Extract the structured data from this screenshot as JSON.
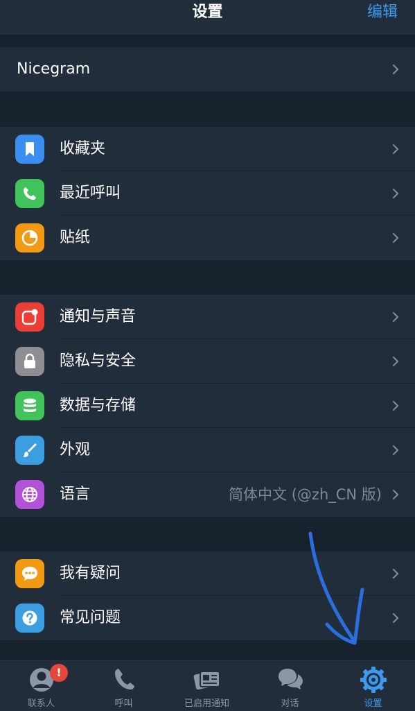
{
  "navbar": {
    "title": "设置",
    "edit_label": "编辑"
  },
  "nicegram": {
    "label": "Nicegram"
  },
  "group1": {
    "items": [
      {
        "label": "收藏夹",
        "icon": "bookmark-icon",
        "color": "#3a8ef0"
      },
      {
        "label": "最近呼叫",
        "icon": "phone-icon",
        "color": "#3fc35a"
      },
      {
        "label": "贴纸",
        "icon": "sticker-icon",
        "color": "#f29a14"
      }
    ]
  },
  "group2": {
    "items": [
      {
        "label": "通知与声音",
        "icon": "notification-icon",
        "color": "#ea3e37"
      },
      {
        "label": "隐私与安全",
        "icon": "lock-icon",
        "color": "#8e8e93"
      },
      {
        "label": "数据与存储",
        "icon": "database-icon",
        "color": "#3fc35a"
      },
      {
        "label": "外观",
        "icon": "brush-icon",
        "color": "#3a9ee0"
      },
      {
        "label": "语言",
        "icon": "globe-icon",
        "color": "#b152d7",
        "value": "简体中文 (@zh_CN 版)"
      }
    ]
  },
  "group3": {
    "items": [
      {
        "label": "我有疑问",
        "icon": "chat-bubble-icon",
        "color": "#f29a14"
      },
      {
        "label": "常见问题",
        "icon": "question-icon",
        "color": "#3a9ee0"
      }
    ]
  },
  "tabbar": {
    "tabs": [
      {
        "label": "联系人",
        "icon": "contacts-icon",
        "badge": "!"
      },
      {
        "label": "呼叫",
        "icon": "phone-icon"
      },
      {
        "label": "已启用通知",
        "icon": "notification-card-icon"
      },
      {
        "label": "对话",
        "icon": "chats-icon"
      },
      {
        "label": "设置",
        "icon": "settings-icon",
        "active": true
      }
    ]
  },
  "colors": {
    "accent": "#3d9bef",
    "background": "#18222d",
    "panel": "#212d3b",
    "annotation_arrow": "#2a6fe0"
  }
}
